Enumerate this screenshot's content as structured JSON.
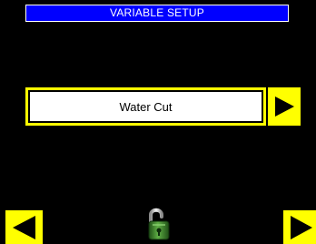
{
  "header": {
    "title": "VARIABLE SETUP"
  },
  "variable": {
    "selected": "Water Cut"
  },
  "navigation": {
    "next_variable_icon": "triangle-right-icon",
    "prev_screen_icon": "triangle-left-icon",
    "next_screen_icon": "triangle-right-icon",
    "lock_icon": "unlocked-padlock-icon"
  },
  "colors": {
    "background": "#000000",
    "title_bar": "#0000ff",
    "button": "#ffff00",
    "arrow": "#000000",
    "lock_body": "#3a7d2a",
    "lock_shackle": "#c8c8c8"
  }
}
